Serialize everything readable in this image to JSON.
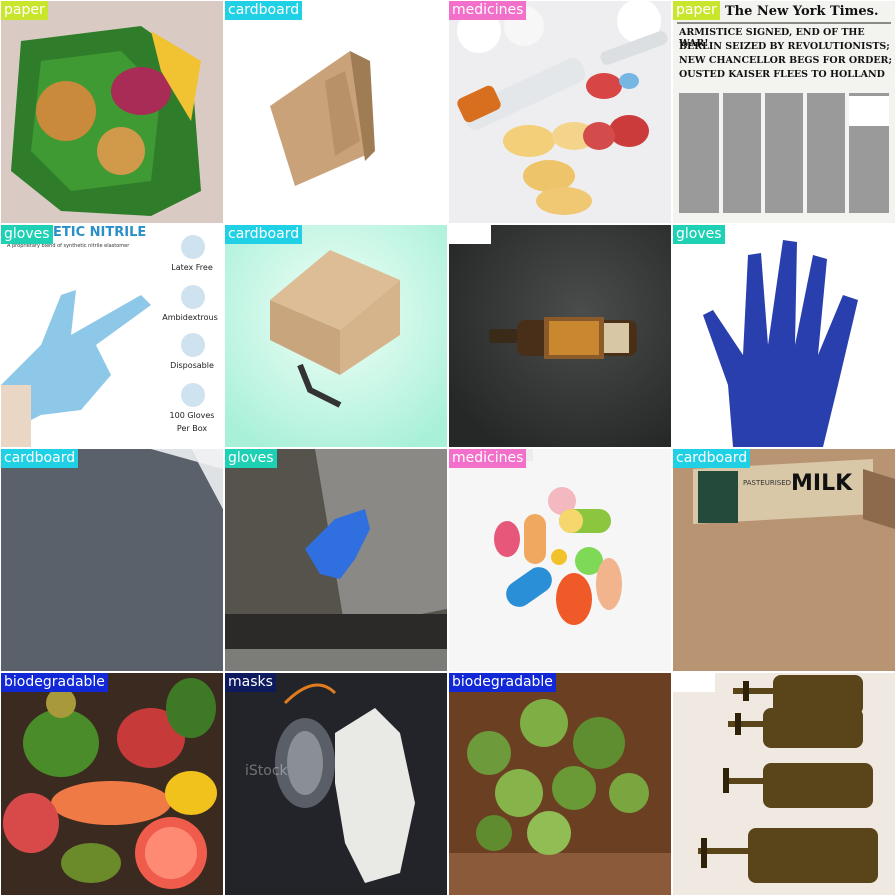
{
  "class_colors": {
    "paper": "#c9e52c",
    "cardboard": "#20d1e5",
    "medicines": "#f270c9",
    "gloves": "#1ed1b4",
    "glass": "#ffffff",
    "biodegradable": "#1228d6",
    "masks": "#0e1a5e"
  },
  "tiles": [
    {
      "label": "paper",
      "label_color": "#c9e52c",
      "scene": "crumpled green biscuit wrapper",
      "icon": "wrapper-icon"
    },
    {
      "label": "cardboard",
      "label_color": "#20d1e5",
      "scene": "brown cardboard box on white",
      "icon": "box-icon"
    },
    {
      "label": "medicines",
      "label_color": "#f270c9",
      "scene": "syringes and yellow/red pills",
      "icon": "pills-icon"
    },
    {
      "label": "paper",
      "label_color": "#c9e52c",
      "scene": "old newspaper front page",
      "icon": "newspaper-icon",
      "text": {
        "masthead": "The New York Times.",
        "headline1": "ARMISTICE SIGNED, END OF THE WAR!",
        "headline2": "BERLIN SEIZED BY REVOLUTIONISTS;",
        "headline3": "NEW CHANCELLOR BEGS FOR ORDER;",
        "headline4": "OUSTED KAISER FLEES TO HOLLAND"
      }
    },
    {
      "label": "gloves",
      "label_color": "#1ed1b4",
      "scene": "blue nitrile glove advert",
      "icon": "glove-icon",
      "text": {
        "title": "ETIC NITRILE",
        "subtitle": "A proprietary blend of synthetic nitrile elastomer",
        "f1": "Latex Free",
        "f2": "Ambidextrous",
        "f3": "Disposable",
        "f4": "100 Gloves",
        "f5": "Per Box"
      }
    },
    {
      "label": "cardboard",
      "label_color": "#20d1e5",
      "scene": "box being cut with knife",
      "icon": "box-icon"
    },
    {
      "label": "glass",
      "label_color": "#ffffff",
      "scene": "beer bottle on dark background",
      "icon": "bottle-icon"
    },
    {
      "label": "gloves",
      "label_color": "#1ed1b4",
      "scene": "blue rubber glove",
      "icon": "glove-icon"
    },
    {
      "label": "cardboard",
      "label_color": "#20d1e5",
      "scene": "grey cardboard sheet",
      "icon": "sheet-icon"
    },
    {
      "label": "gloves",
      "label_color": "#1ed1b4",
      "scene": "blue glove on pavement",
      "icon": "glove-icon"
    },
    {
      "label": "medicines",
      "label_color": "#f270c9",
      "scene": "assorted pills and capsules",
      "icon": "pills-icon"
    },
    {
      "label": "cardboard",
      "label_color": "#20d1e5",
      "scene": "milk carton on shelf",
      "icon": "carton-icon",
      "text": {
        "milk": "MILK",
        "past": "PASTEURISED"
      }
    },
    {
      "label": "biodegradable",
      "label_color": "#1228d6",
      "scene": "assorted healthy foods",
      "icon": "food-icon"
    },
    {
      "label": "masks",
      "label_color": "#0e1a5e",
      "scene": "mask and glove on dark surface",
      "icon": "mask-icon",
      "text": {
        "watermark": "iStock"
      }
    },
    {
      "label": "biodegradable",
      "label_color": "#1228d6",
      "scene": "brussels sprouts",
      "icon": "vegetable-icon"
    },
    {
      "label": "glass",
      "label_color": "#ffffff",
      "scene": "amber goblets on wood",
      "icon": "goblet-icon"
    }
  ]
}
